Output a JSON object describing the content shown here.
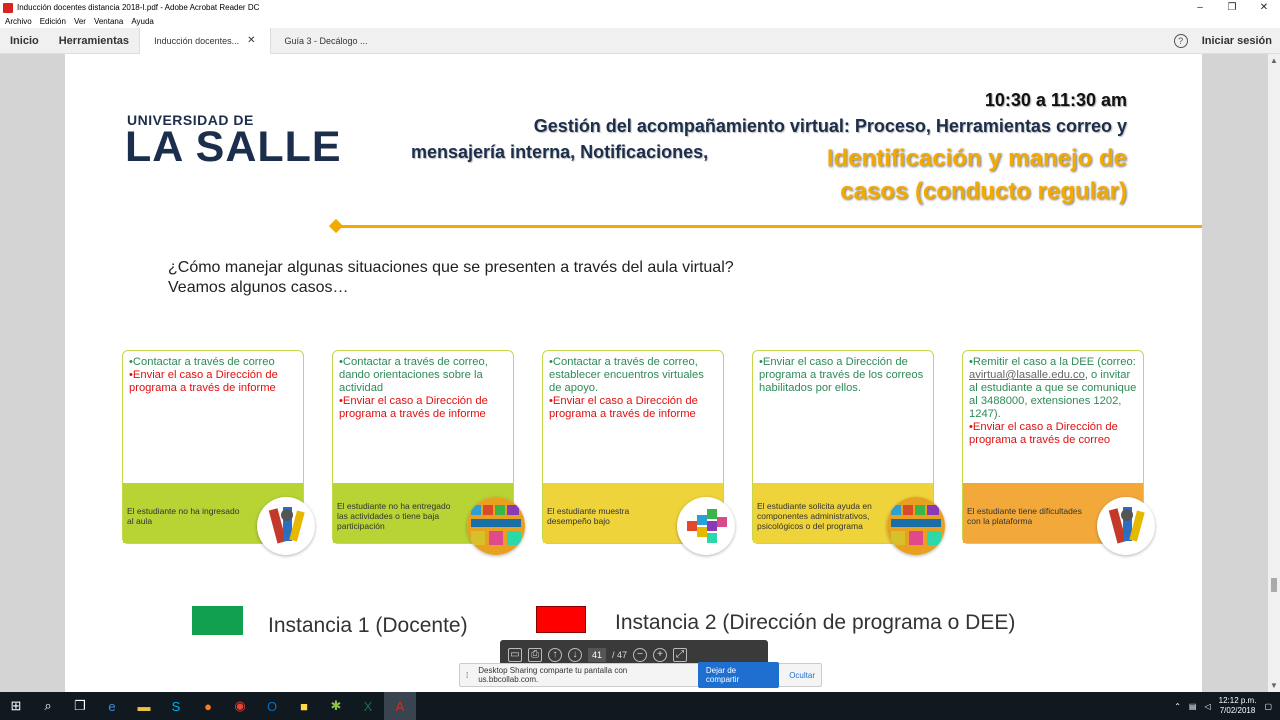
{
  "window": {
    "title": "Inducción docentes distancia 2018-I.pdf - Adobe Acrobat Reader DC",
    "menu": [
      "Archivo",
      "Edición",
      "Ver",
      "Ventana",
      "Ayuda"
    ]
  },
  "tabs": {
    "home": "Inicio",
    "tools": "Herramientas",
    "doc1": "Inducción docentes...",
    "doc2": "Guía 3 - Decálogo ...",
    "signin": "Iniciar sesión"
  },
  "slide": {
    "logo_top": "UNIVERSIDAD DE",
    "logo_main": "LA SALLE",
    "time": "10:30 a 11:30 am",
    "heading_line1": "Gestión del acompañamiento virtual: Proceso, Herramientas correo y",
    "heading_line2": "mensajería interna, Notificaciones,",
    "highlight": "Identificación y manejo de casos (conducto regular)",
    "question_line1": "¿Cómo manejar algunas situaciones que se presenten a través del aula virtual?",
    "question_line2": "Veamos algunos casos…",
    "cards": [
      {
        "green": "•Contactar a través de correo",
        "red": "•Enviar el caso a Dirección de programa a través de informe",
        "foot": "El estudiante no ha ingresado al aula"
      },
      {
        "green": "•Contactar a través de correo, dando orientaciones sobre la actividad",
        "red": "•Enviar el caso a Dirección de programa a través de informe",
        "foot": "El estudiante no ha entregado las actividades o tiene baja participación"
      },
      {
        "green": "•Contactar a través de correo, establecer encuentros virtuales de apoyo.",
        "red": "•Enviar el caso a Dirección de programa a través de informe",
        "foot": "El estudiante muestra desempeño bajo"
      },
      {
        "green": "•Enviar el caso a Dirección de programa a través de los correos habilitados por ellos.",
        "red": "",
        "foot": "El estudiante solicita ayuda en componentes administrativos, psicológicos o del programa"
      },
      {
        "green_a": "•Remitir el caso a la DEE (correo:",
        "email": "avirtual@lasalle.edu.co",
        "green_b": ", o invitar al estudiante a que se comunique al 3488000, extensiones 1202, 1247).",
        "red": "•Enviar el caso a Dirección de programa a través de correo",
        "foot": "El estudiante tiene dificultades con la plataforma"
      }
    ],
    "legend1": "Instancia 1 (Docente)",
    "legend2": "Instancia 2 (Dirección de programa o DEE)"
  },
  "toolbar": {
    "page_current": "41",
    "page_total": "/ 47"
  },
  "share": {
    "message": "Desktop Sharing comparte tu pantalla con us.bbcollab.com.",
    "stop": "Dejar de compartir",
    "hide": "Ocultar"
  },
  "taskbar": {
    "time": "12:12 p.m.",
    "date": "7/02/2018"
  },
  "colors": {
    "accent": "#f2a900",
    "instance1": "#10a050",
    "instance2": "#ff0000"
  }
}
